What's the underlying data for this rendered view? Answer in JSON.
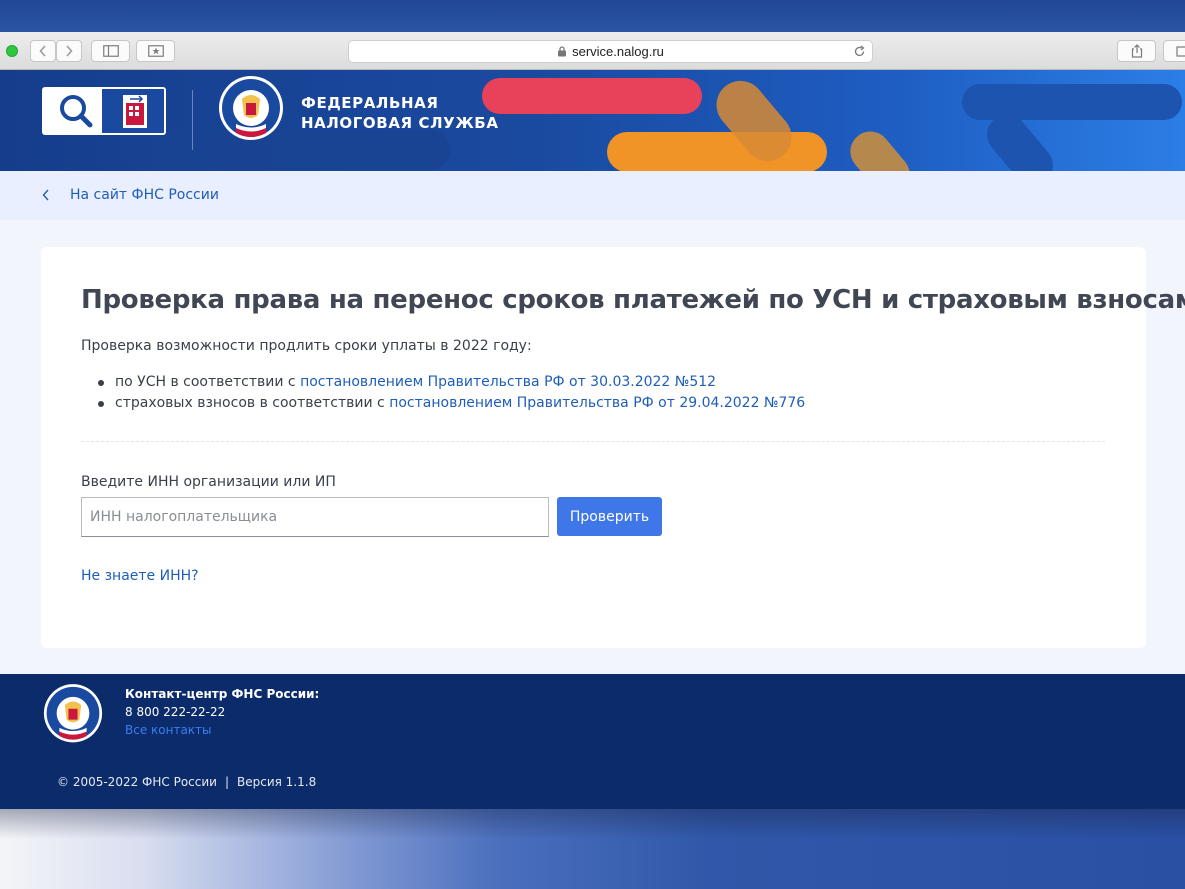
{
  "browser": {
    "url": "service.nalog.ru"
  },
  "header": {
    "org_line1": "ФЕДЕРАЛЬНАЯ",
    "org_line2": "НАЛОГОВАЯ СЛУЖБА"
  },
  "nav": {
    "back_label": "На сайт ФНС России"
  },
  "main": {
    "title": "Проверка права на перенос сроков платежей по УСН и страховым взносам",
    "intro": "Проверка возможности продлить сроки уплаты в 2022 году:",
    "bullets": [
      {
        "text": "по УСН в соответствии с ",
        "link": "постановлением Правительства РФ от 30.03.2022 №512"
      },
      {
        "text": "страховых взносов в соответствии с ",
        "link": "постановлением Правительства РФ от 29.04.2022 №776"
      }
    ],
    "field_label": "Введите ИНН организации или ИП",
    "input_placeholder": "ИНН налогоплательщика",
    "input_value": "",
    "check_button": "Проверить",
    "no_inn_link": "Не знаете ИНН?"
  },
  "footer": {
    "contact_title": "Контакт-центр ФНС России:",
    "phone": "8 800 222-22-22",
    "all_contacts": "Все контакты",
    "copyright": "© 2005-2022 ФНС России",
    "separator": "|",
    "version": "Версия 1.1.8"
  },
  "colors": {
    "brand_blue": "#0b2b6a",
    "accent_button": "#3f77e8",
    "link": "#1f5eb8",
    "banner_red": "#e8425a",
    "banner_orange": "#f6a21f"
  }
}
